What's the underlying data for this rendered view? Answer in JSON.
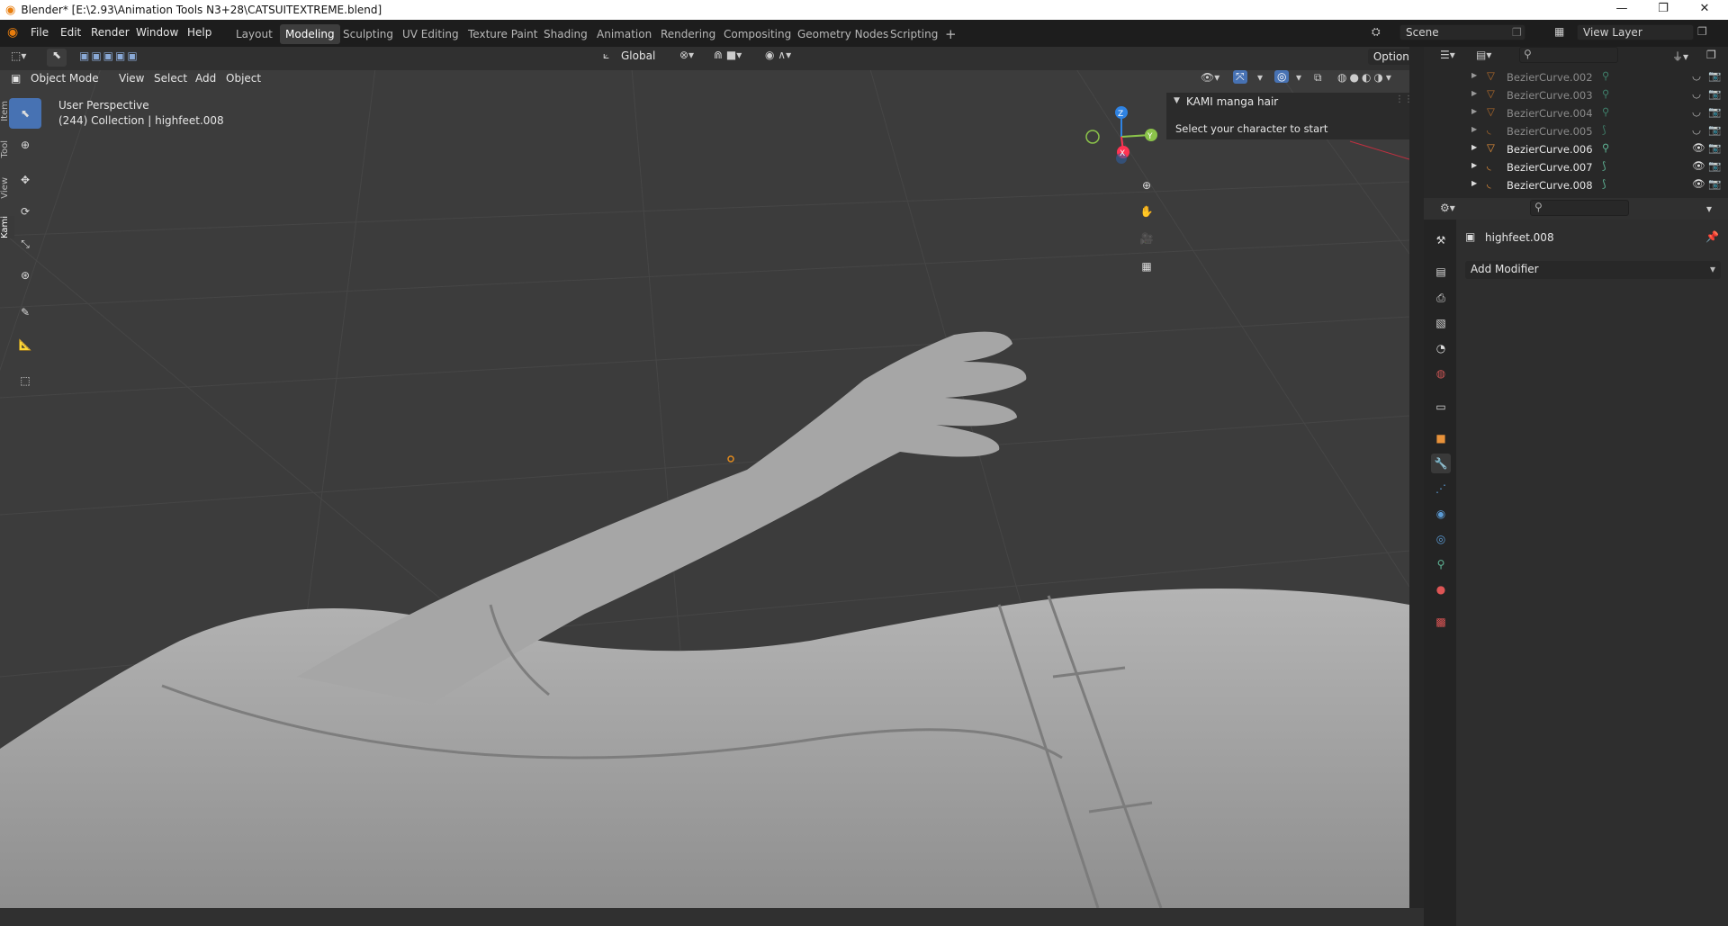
{
  "title": "Blender* [E:\\2.93\\Animation Tools N3+28\\CATSUITEXTREME.blend]",
  "window_controls": {
    "minimize": "—",
    "maximize": "❐",
    "close": "✕"
  },
  "menus": [
    "File",
    "Edit",
    "Render",
    "Window",
    "Help"
  ],
  "workspaces": [
    "Layout",
    "Modeling",
    "Sculpting",
    "UV Editing",
    "Texture Paint",
    "Shading",
    "Animation",
    "Rendering",
    "Compositing",
    "Geometry Nodes",
    "Scripting"
  ],
  "active_workspace": "Modeling",
  "add_workspace": "+",
  "scene": "Scene",
  "view_layer": "View Layer",
  "viewport": {
    "mode": "Object Mode",
    "menus": [
      "View",
      "Select",
      "Add",
      "Object"
    ],
    "transform_orientation": "Global",
    "options": "Options",
    "info_line1": "User Perspective",
    "info_line2": "(244) Collection | highfeet.008",
    "gizmo": {
      "z": "Z",
      "y": "Y",
      "x": "X"
    }
  },
  "kami_panel": {
    "title": "KAMI manga hair",
    "text": "Select your character to start"
  },
  "sidebar_tabs": [
    "Item",
    "Tool",
    "View",
    "Kami"
  ],
  "outliner": [
    {
      "name": "BezierCurve.002",
      "dim": true
    },
    {
      "name": "BezierCurve.003",
      "dim": true
    },
    {
      "name": "BezierCurve.004",
      "dim": true
    },
    {
      "name": "BezierCurve.005",
      "dim": true
    },
    {
      "name": "BezierCurve.006",
      "dim": false
    },
    {
      "name": "BezierCurve.007",
      "dim": false
    },
    {
      "name": "BezierCurve.008",
      "dim": false
    }
  ],
  "properties": {
    "object_name": "highfeet.008",
    "add_modifier": "Add Modifier"
  },
  "colors": {
    "accent": "#4772b3",
    "axis_x": "#ff3352",
    "axis_y": "#8bc34a",
    "axis_z": "#2f83e3",
    "curve_icon": "#e8923a",
    "data_icon": "#5fb596"
  }
}
